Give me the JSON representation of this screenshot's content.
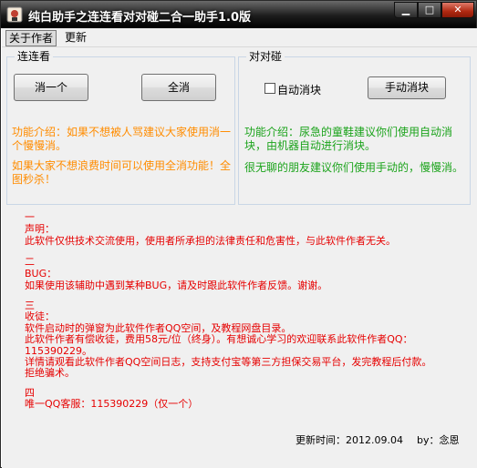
{
  "window": {
    "title": "纯白助手之连连看对对碰二合一助手1.0版"
  },
  "menu": {
    "items": [
      {
        "label": "关于作者"
      },
      {
        "label": "更新"
      }
    ]
  },
  "lianliankan": {
    "title": "连连看",
    "btn_one": "消一个",
    "btn_all": "全消",
    "intro_lines": [
      "功能介绍：如果不想被人骂建议大家使用消一",
      "个慢慢消。"
    ],
    "tip_lines": [
      "如果大家不想浪费时间可以使用全消功能！全",
      "图秒杀！"
    ]
  },
  "duiduipeng": {
    "title": "对对碰",
    "auto_label": "自动消块",
    "auto_checked": false,
    "manual_btn": "手动消块",
    "intro_lines": [
      "功能介绍：尿急的童鞋建议你们使用自动消",
      "块，由机器自动进行消块。"
    ],
    "tip_line": "很无聊的朋友建议你们使用手动的，慢慢消。"
  },
  "notice": {
    "s1_num": "一",
    "s1_title": "声明：",
    "s1_text": "此软件仅供技术交流使用，使用者所承担的法律责任和危害性，与此软件作者无关。",
    "s2_num": "二",
    "s2_title": "BUG：",
    "s2_text": "如果使用该辅助中遇到某种BUG，请及时跟此软件作者反馈。谢谢。",
    "s3_num": "三",
    "s3_title": "收徒：",
    "s3_lines": [
      "软件启动时的弹窗为此软件作者QQ空间，及教程网盘目录。",
      "此软件作者有偿收徒，费用58元/位（终身）。有想诚心学习的欢迎联系此软件作者QQ：",
      "115390229。",
      "详情请观看此软件作者QQ空间日志，支持支付宝等第三方担保交易平台，发完教程后付款。",
      "拒绝骗术。"
    ],
    "s4_num": "四",
    "s4_text": "唯一QQ客服：115390229（仅一个）"
  },
  "footer": {
    "update_time": "更新时间：2012.09.04",
    "author": "by：念恩"
  },
  "colors": {
    "orange": "#ff8c00",
    "green": "#1ba31b",
    "red": "#e60000"
  }
}
